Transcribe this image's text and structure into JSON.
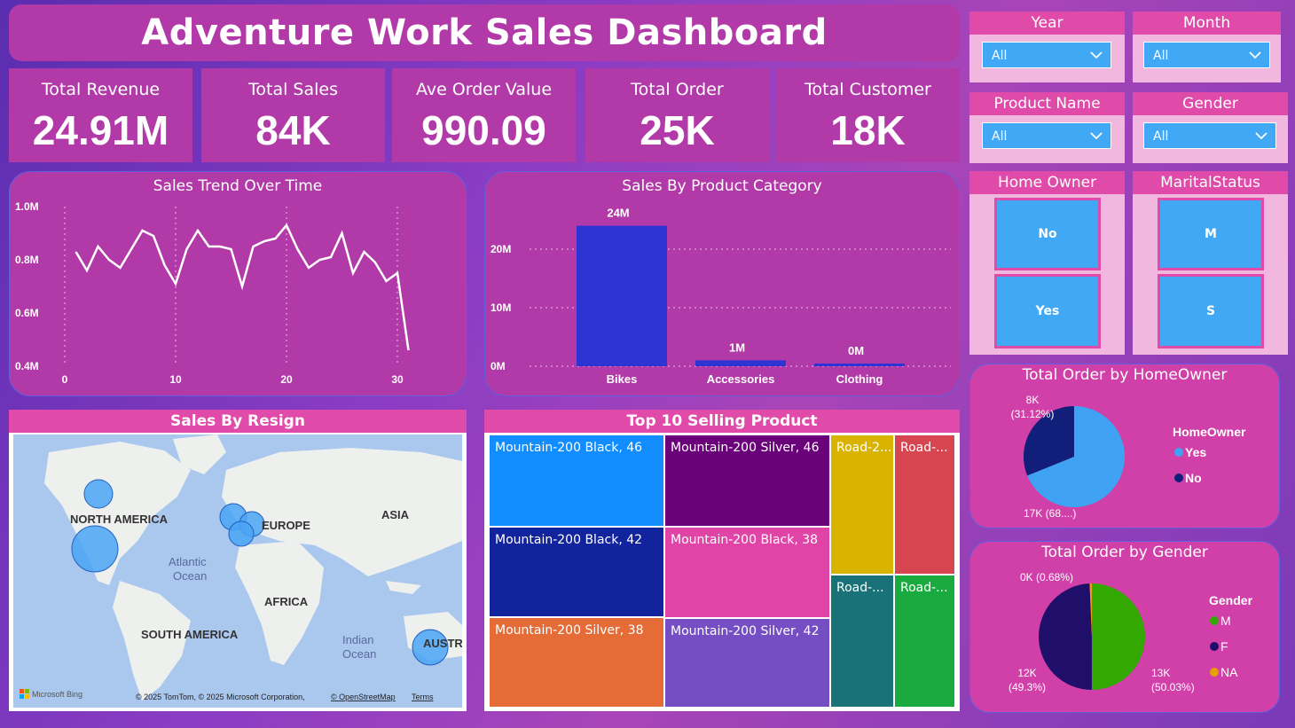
{
  "header": {
    "title": "Adventure Work Sales Dashboard"
  },
  "kpis": [
    {
      "label": "Total Revenue",
      "value": "24.91M"
    },
    {
      "label": "Total Sales",
      "value": "84K"
    },
    {
      "label": "Ave Order Value",
      "value": "990.09"
    },
    {
      "label": "Total Order",
      "value": "25K"
    },
    {
      "label": "Total Customer",
      "value": "18K"
    }
  ],
  "slicers": {
    "year": {
      "label": "Year",
      "value": "All"
    },
    "month": {
      "label": "Month",
      "value": "All"
    },
    "product": {
      "label": "Product Name",
      "value": "All"
    },
    "gender": {
      "label": "Gender",
      "value": "All"
    },
    "home_owner": {
      "label": "Home Owner",
      "options": [
        "No",
        "Yes"
      ]
    },
    "marital": {
      "label": "MaritalStatus",
      "options": [
        "M",
        "S"
      ]
    }
  },
  "chart_data": [
    {
      "type": "line",
      "title": "Sales Trend Over Time",
      "x": [
        1,
        2,
        3,
        4,
        5,
        6,
        7,
        8,
        9,
        10,
        11,
        12,
        13,
        14,
        15,
        16,
        17,
        18,
        19,
        20,
        21,
        22,
        23,
        24,
        25,
        26,
        27,
        28,
        29,
        30,
        31
      ],
      "values": [
        0.83,
        0.76,
        0.85,
        0.8,
        0.77,
        0.84,
        0.91,
        0.89,
        0.78,
        0.71,
        0.84,
        0.91,
        0.85,
        0.85,
        0.84,
        0.7,
        0.85,
        0.87,
        0.88,
        0.93,
        0.84,
        0.77,
        0.8,
        0.81,
        0.9,
        0.75,
        0.83,
        0.79,
        0.72,
        0.75,
        0.46
      ],
      "yticks": [
        "1.0M",
        "0.8M",
        "0.6M",
        "0.4M"
      ],
      "xticks": [
        "0",
        "10",
        "20",
        "30"
      ],
      "ylim": [
        0.4,
        1.0
      ],
      "xlim": [
        0,
        31
      ],
      "color": "#ffffff"
    },
    {
      "type": "bar",
      "title": "Sales By Product Category",
      "categories": [
        "Bikes",
        "Accessories",
        "Clothing"
      ],
      "values": [
        24,
        1,
        0.3
      ],
      "data_labels": [
        "24M",
        "1M",
        "0M"
      ],
      "yticks": [
        "20M",
        "10M",
        "0M"
      ],
      "ylim": [
        0,
        20
      ],
      "color": "#2c34d4"
    },
    {
      "type": "pie",
      "title": "Total Order by HomeOwner",
      "legend_title": "HomeOwner",
      "slices": [
        {
          "name": "Yes",
          "value": 68.88,
          "label": "17K (68....)",
          "color": "#3fa2f2"
        },
        {
          "name": "No",
          "value": 31.12,
          "label": "8K (31.12%)",
          "color": "#111e7a"
        }
      ]
    },
    {
      "type": "pie",
      "title": "Total Order by Gender",
      "legend_title": "Gender",
      "slices": [
        {
          "name": "M",
          "value": 50.03,
          "label": "13K (50.03%)",
          "color": "#33a800"
        },
        {
          "name": "F",
          "value": 49.3,
          "label": "12K (49.3%)",
          "color": "#1f0f6a"
        },
        {
          "name": "NA",
          "value": 0.68,
          "label": "0K (0.68%)",
          "color": "#e8a000"
        }
      ]
    }
  ],
  "map": {
    "title": "Sales By Resign",
    "labels": [
      "NORTH AMERICA",
      "EUROPE",
      "ASIA",
      "AFRICA",
      "SOUTH AMERICA",
      "Atlantic",
      "Ocean",
      "Indian",
      "Ocean",
      "AUSTR"
    ],
    "attribution": "© 2025 TomTom, © 2025 Microsoft Corporation,",
    "osm": "© OpenStreetMap",
    "terms": "Terms",
    "bing": "Microsoft Bing"
  },
  "treemap": {
    "title": "Top 10 Selling Product",
    "cells": [
      {
        "label": "Mountain-200 Black, 46",
        "color": "#118dff"
      },
      {
        "label": "Mountain-200 Silver, 46",
        "color": "#6b007b"
      },
      {
        "label": "Road-2...",
        "color": "#d9b300"
      },
      {
        "label": "Road-...",
        "color": "#d64550"
      },
      {
        "label": "Mountain-200 Black, 42",
        "color": "#12239e"
      },
      {
        "label": "Mountain-200 Black, 38",
        "color": "#e044a7"
      },
      {
        "label": "Mountain-200 Silver, 38",
        "color": "#e66c37"
      },
      {
        "label": "Mountain-200 Silver, 42",
        "color": "#744ec2"
      },
      {
        "label": "Road-...",
        "color": "#197278"
      },
      {
        "label": "Road-...",
        "color": "#1aab40"
      }
    ]
  }
}
